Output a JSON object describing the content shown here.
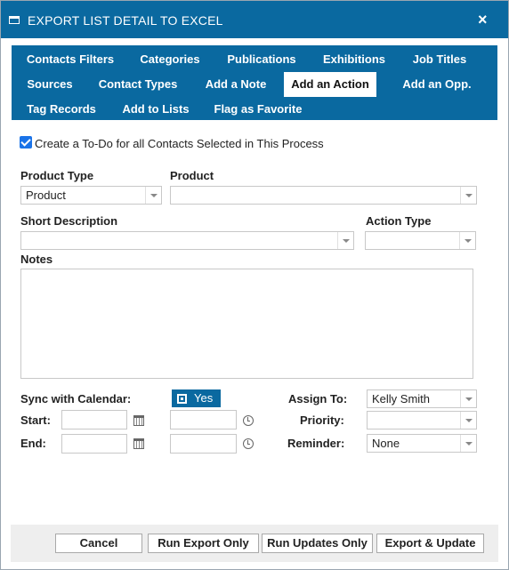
{
  "window": {
    "title": "EXPORT LIST DETAIL TO EXCEL",
    "close_label": "×"
  },
  "tabs": [
    {
      "label": "Contacts Filters"
    },
    {
      "label": "Categories"
    },
    {
      "label": "Publications"
    },
    {
      "label": "Exhibitions"
    },
    {
      "label": "Job Titles"
    },
    {
      "label": "Sources"
    },
    {
      "label": "Contact Types"
    },
    {
      "label": "Add a Note"
    },
    {
      "label": "Add an Action",
      "active": true
    },
    {
      "label": "Add an Opp."
    },
    {
      "label": "Tag Records"
    },
    {
      "label": "Add to Lists"
    },
    {
      "label": "Flag as Favorite"
    }
  ],
  "todo": {
    "checked": true,
    "label": "Create a To-Do for all Contacts Selected in This Process"
  },
  "form": {
    "product_type": {
      "label": "Product Type",
      "value": "Product"
    },
    "product": {
      "label": "Product",
      "value": ""
    },
    "short_description": {
      "label": "Short Description",
      "value": ""
    },
    "action_type": {
      "label": "Action Type",
      "value": ""
    },
    "notes": {
      "label": "Notes",
      "value": ""
    },
    "sync": {
      "label": "Sync with Calendar:",
      "toggle_label": "Yes"
    },
    "start": {
      "label": "Start:",
      "date": "",
      "time": ""
    },
    "end": {
      "label": "End:",
      "date": "",
      "time": ""
    },
    "assign_to": {
      "label": "Assign To:",
      "value": "Kelly Smith"
    },
    "priority": {
      "label": "Priority:",
      "value": ""
    },
    "reminder": {
      "label": "Reminder:",
      "value": "None"
    }
  },
  "footer": {
    "cancel": "Cancel",
    "run_export_only": "Run Export Only",
    "run_updates_only": "Run Updates Only",
    "export_update": "Export & Update"
  },
  "colors": {
    "accent": "#0a69a0",
    "checkbox": "#1a73e8",
    "footer_bg": "#eeeeee"
  }
}
